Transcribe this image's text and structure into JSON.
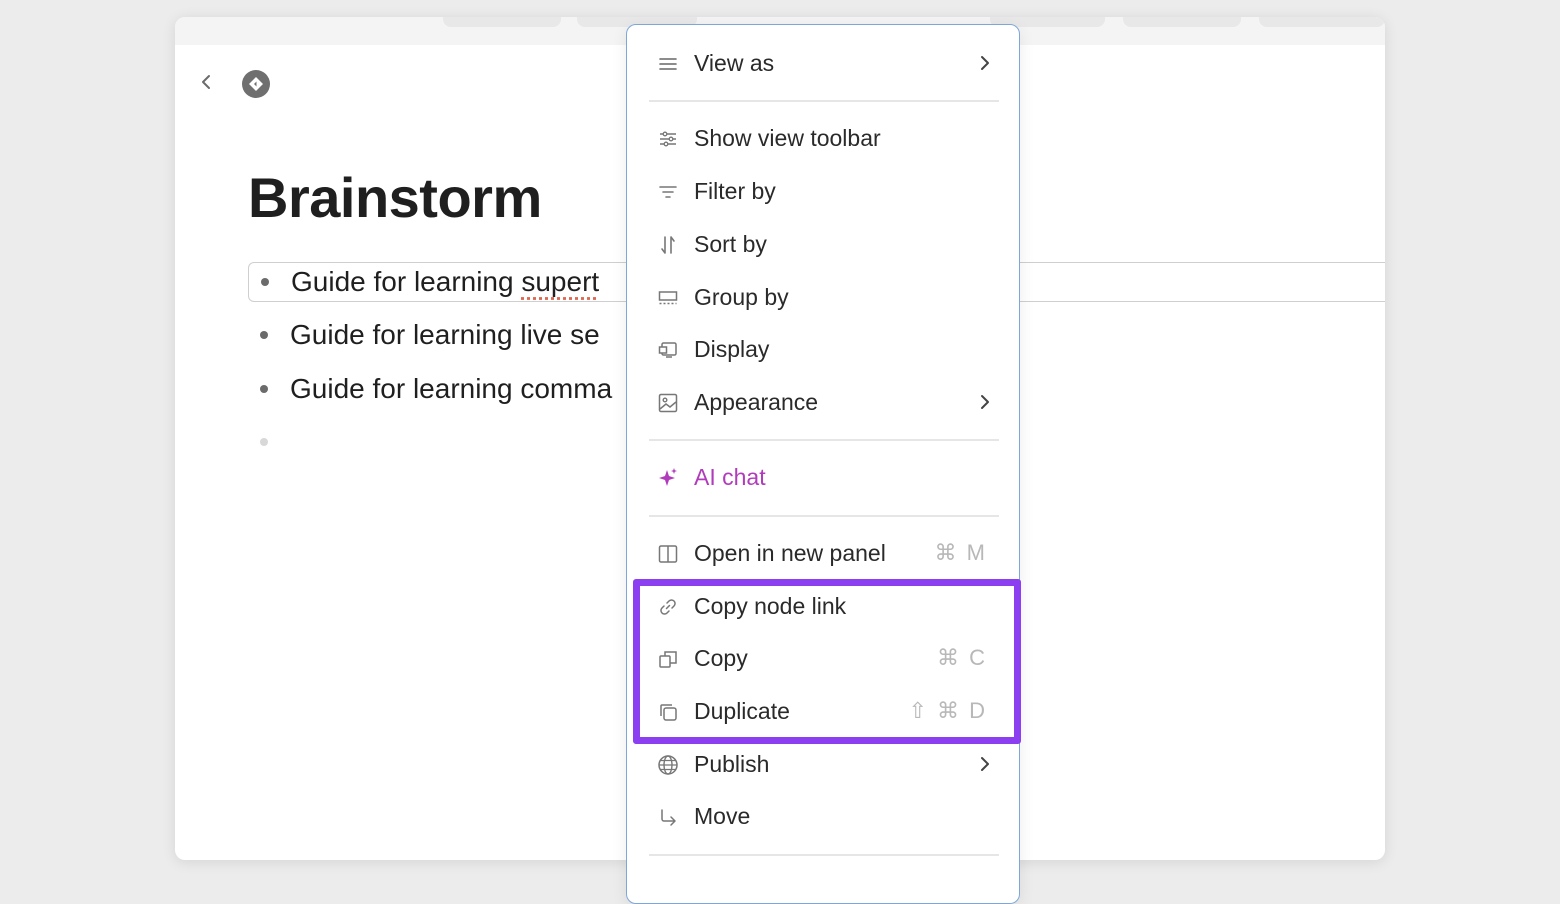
{
  "page": {
    "title": "Brainstorm"
  },
  "outline": {
    "items": [
      {
        "text": "Guide for learning supert"
      },
      {
        "text": "Guide for learning live se"
      },
      {
        "text": "Guide for learning comma"
      },
      {
        "text": ""
      }
    ]
  },
  "menu": {
    "view_as": "View as",
    "show_view_toolbar": "Show view toolbar",
    "filter_by": "Filter by",
    "sort_by": "Sort by",
    "group_by": "Group by",
    "display": "Display",
    "appearance": "Appearance",
    "ai_chat": "AI chat",
    "open_in_new_panel": "Open in new panel",
    "open_in_new_panel_shortcut": "⌘ M",
    "copy_node_link": "Copy node link",
    "copy": "Copy",
    "copy_shortcut": "⌘ C",
    "duplicate": "Duplicate",
    "duplicate_shortcut": "⇧ ⌘ D",
    "publish": "Publish",
    "move": "Move"
  },
  "colors": {
    "highlight": "#8b3ff0",
    "ai_accent": "#b13cbb",
    "menu_border": "#7ea7d8"
  },
  "icons": {
    "view_as": "list-icon",
    "show_view_toolbar": "sliders-icon",
    "filter_by": "filter-icon",
    "sort_by": "sort-icon",
    "group_by": "group-icon",
    "display": "display-icon",
    "appearance": "image-icon",
    "ai_chat": "sparkle-icon",
    "open_in_new_panel": "panel-icon",
    "copy_node_link": "link-icon",
    "copy": "copy-icon",
    "duplicate": "duplicate-icon",
    "publish": "globe-icon",
    "move": "move-arrow-icon"
  }
}
